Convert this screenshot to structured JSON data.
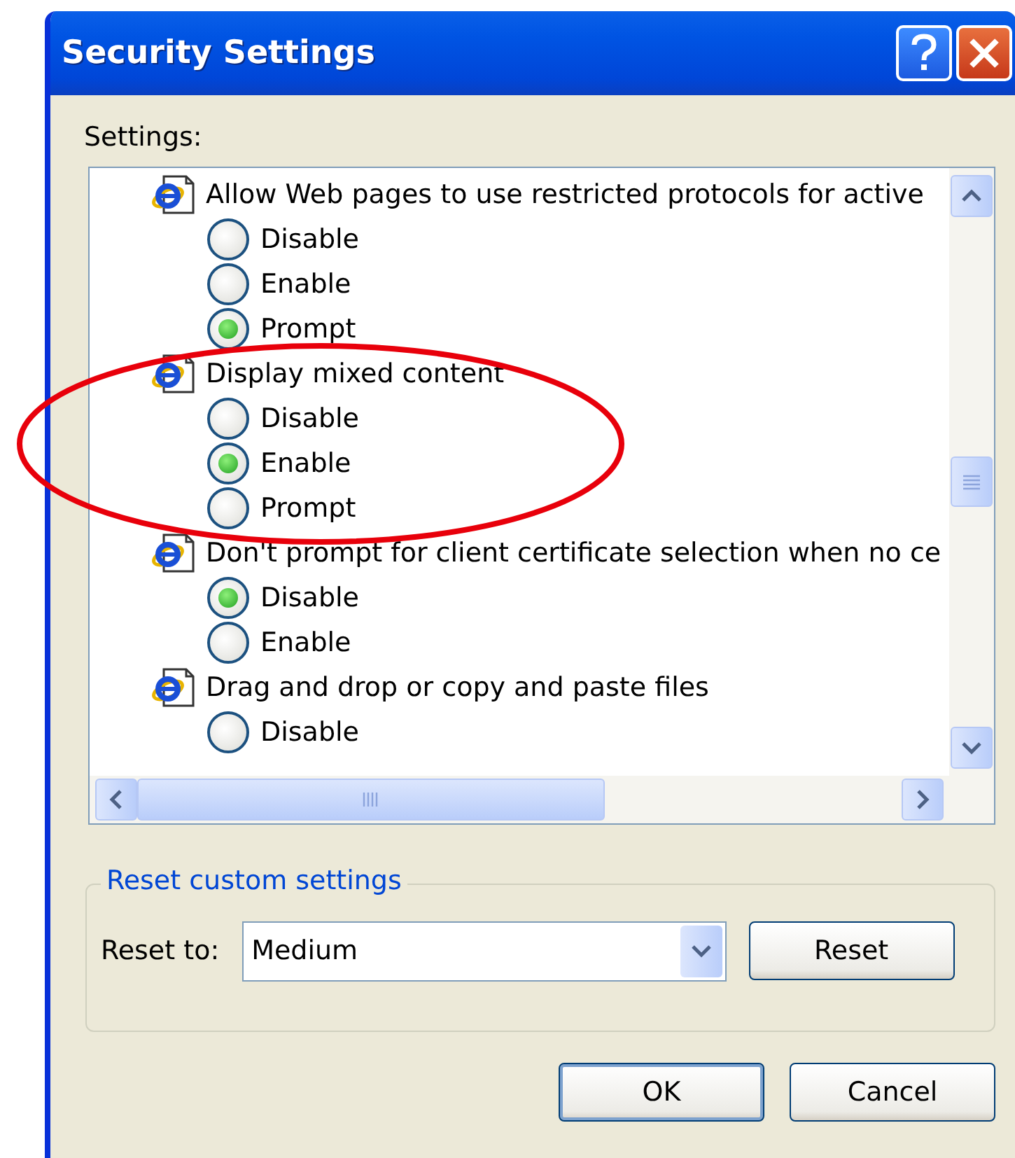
{
  "window": {
    "title": "Security Settings"
  },
  "settings_label": "Settings:",
  "settings": [
    {
      "label": "Allow Web pages to use restricted protocols for active",
      "options": [
        {
          "label": "Disable",
          "selected": false
        },
        {
          "label": "Enable",
          "selected": false
        },
        {
          "label": "Prompt",
          "selected": true
        }
      ]
    },
    {
      "label": "Display mixed content",
      "options": [
        {
          "label": "Disable",
          "selected": false
        },
        {
          "label": "Enable",
          "selected": true
        },
        {
          "label": "Prompt",
          "selected": false
        }
      ]
    },
    {
      "label": "Don't prompt for client certificate selection when no ce",
      "options": [
        {
          "label": "Disable",
          "selected": true
        },
        {
          "label": "Enable",
          "selected": false
        }
      ]
    },
    {
      "label": "Drag and drop or copy and paste files",
      "options": [
        {
          "label": "Disable",
          "selected": false
        }
      ]
    }
  ],
  "reset_group": {
    "title": "Reset custom settings",
    "label": "Reset to:",
    "value": "Medium",
    "button": "Reset"
  },
  "buttons": [
    "OK",
    "Cancel"
  ]
}
